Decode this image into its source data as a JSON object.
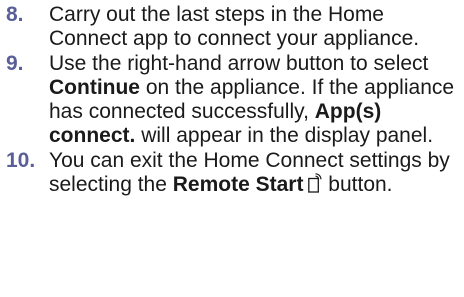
{
  "steps": [
    {
      "number": "8.",
      "text": "Carry out the last steps in the Home Connect app to connect your appliance."
    },
    {
      "number": "9.",
      "text_1": "Use the right-hand arrow button to select ",
      "bold_1": "Continue",
      "text_2": " on the appliance. If the appliance has connected successfully, ",
      "bold_2": "App(s) connect.",
      "text_3": " will appear in the display panel."
    },
    {
      "number": "10.",
      "text_1": "You can exit the Home Connect settings by selecting the ",
      "bold_1": "Remote Start",
      "icon": "remote-start-icon",
      "text_2": " button."
    }
  ],
  "colors": {
    "step_number": "#5a5f97",
    "body_text": "#1a1a1a"
  }
}
